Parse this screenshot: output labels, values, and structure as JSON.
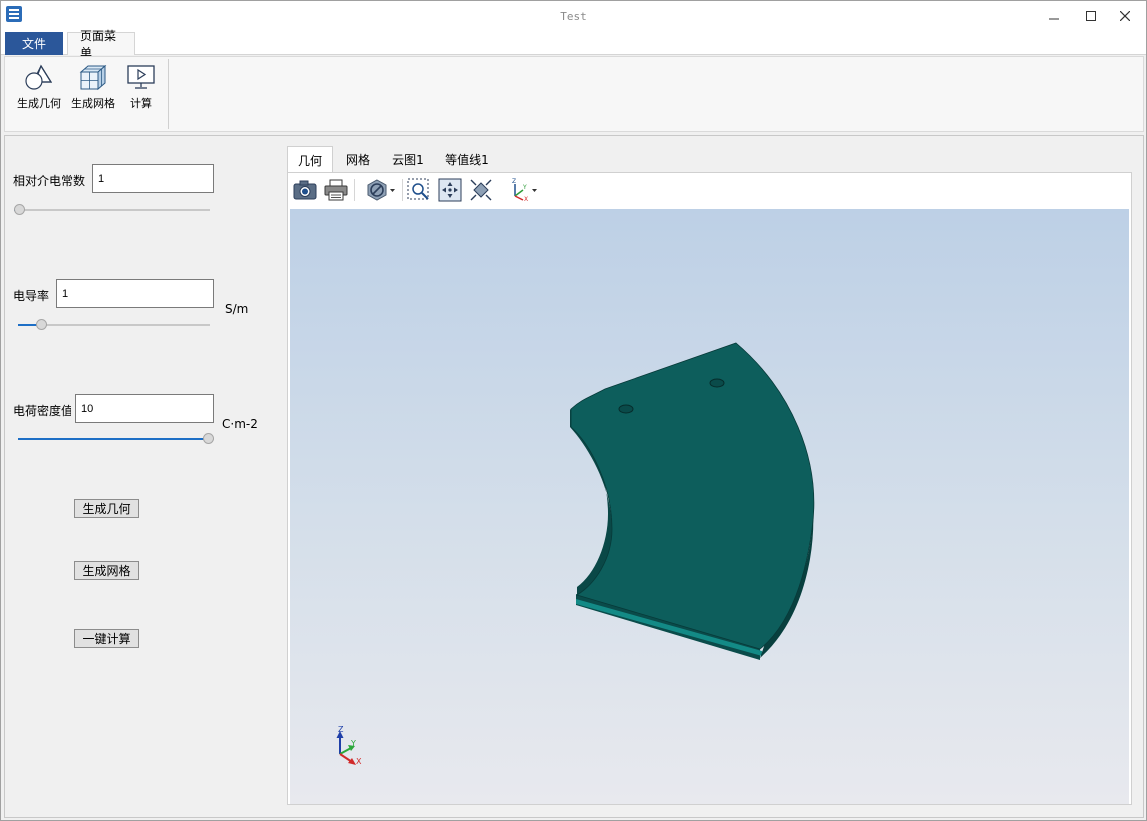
{
  "window": {
    "title": "Test"
  },
  "ribbon": {
    "tabs": [
      "文件",
      "页面菜单"
    ],
    "buttons": {
      "geometry": "生成几何",
      "mesh": "生成网格",
      "compute": "计算"
    }
  },
  "form": {
    "permittivity": {
      "label": "相对介电常数",
      "value": "1",
      "slider_fraction": 0.0
    },
    "conductivity": {
      "label": "电导率",
      "value": "1",
      "unit": "S/m",
      "slider_fraction": 0.1
    },
    "charge_density": {
      "label": "电荷密度值",
      "value": "10",
      "unit": "C·m-2",
      "slider_fraction": 1.0
    },
    "buttons": {
      "geometry": "生成几何",
      "mesh": "生成网格",
      "compute": "一键计算"
    }
  },
  "viewer": {
    "tabs": [
      "几何",
      "网格",
      "云图1",
      "等值线1"
    ],
    "active_tab": "几何",
    "toolbar_icons": [
      "camera-icon",
      "print-icon",
      "display-mode-icon",
      "zoom-box-icon",
      "fit-view-icon",
      "view-direction-icon",
      "axis-orientation-icon"
    ],
    "triad": {
      "z": "Z",
      "y": "Y",
      "x": "X"
    },
    "model_color": "#0d5e5c"
  }
}
